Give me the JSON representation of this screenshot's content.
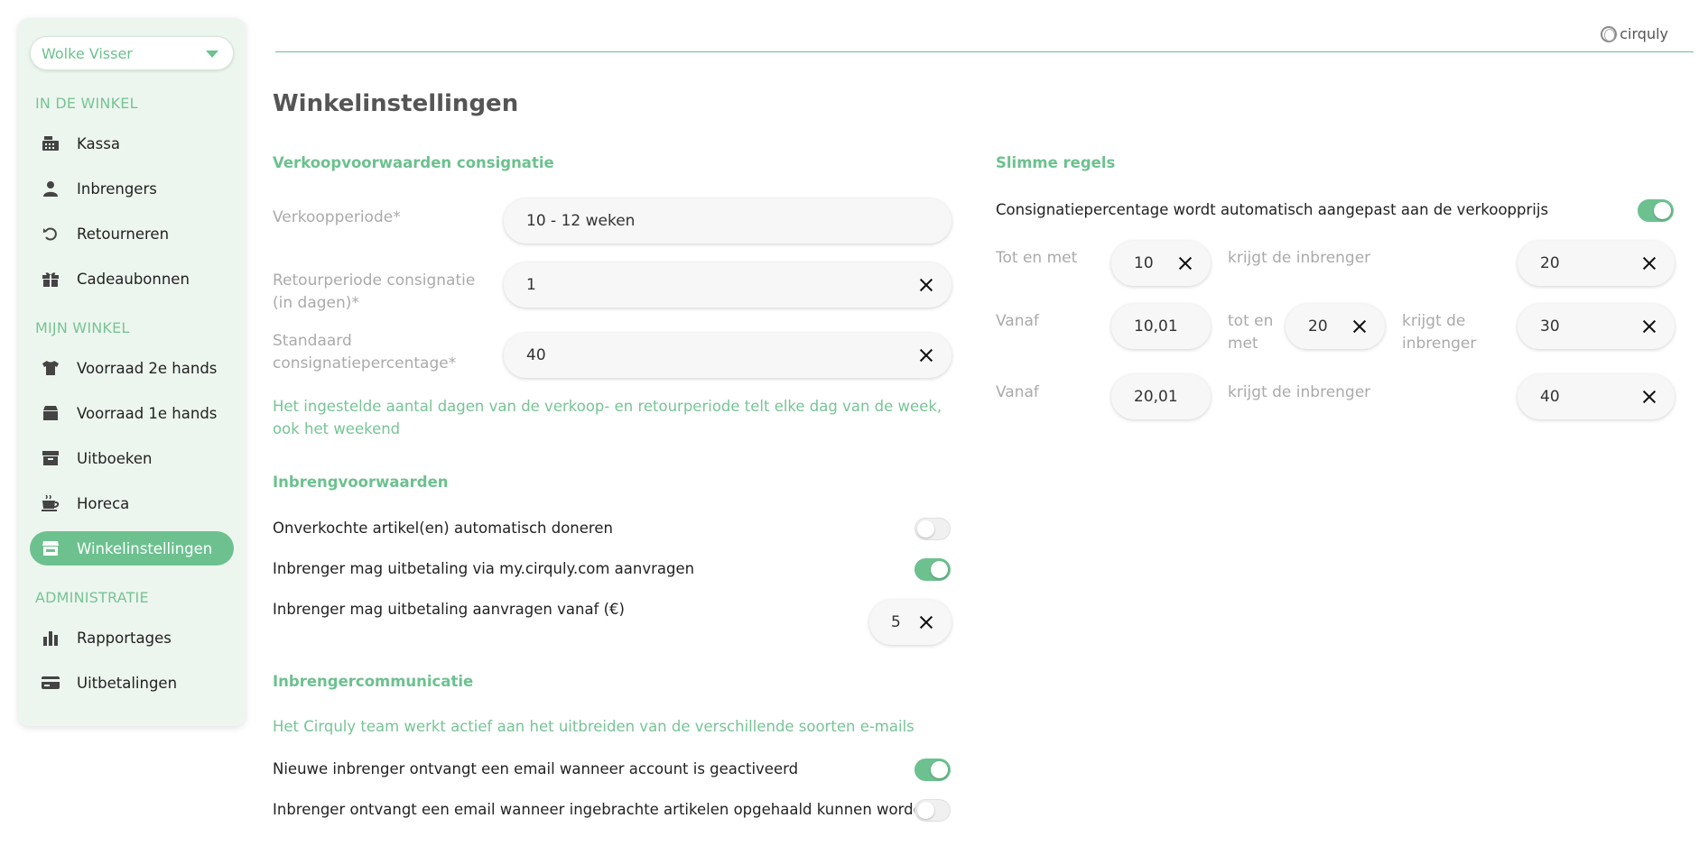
{
  "sidebar": {
    "user": "Wolke Visser",
    "sections": [
      {
        "label": "IN DE WINKEL"
      },
      {
        "label": "MIJN WINKEL"
      },
      {
        "label": "ADMINISTRATIE"
      }
    ],
    "items": [
      {
        "label": "Kassa",
        "icon": "cash-register-icon"
      },
      {
        "label": "Inbrengers",
        "icon": "person-icon"
      },
      {
        "label": "Retourneren",
        "icon": "undo-icon"
      },
      {
        "label": "Cadeaubonnen",
        "icon": "gift-icon"
      },
      {
        "label": "Voorraad 2e hands",
        "icon": "shirt-icon"
      },
      {
        "label": "Voorraad 1e hands",
        "icon": "box-icon"
      },
      {
        "label": "Uitboeken",
        "icon": "archive-icon"
      },
      {
        "label": "Horeca",
        "icon": "coffee-icon"
      },
      {
        "label": "Winkelinstellingen",
        "icon": "store-icon",
        "active": true
      },
      {
        "label": "Rapportages",
        "icon": "bar-chart-icon"
      },
      {
        "label": "Uitbetalingen",
        "icon": "credit-card-icon"
      }
    ]
  },
  "header": {
    "logo": "cirquly",
    "accent": "#6cc18f"
  },
  "page": {
    "title": "Winkelinstellingen"
  },
  "sales": {
    "heading": "Verkoopvoorwaarden consignatie",
    "period_label": "Verkoopperiode*",
    "period_value": "10 - 12 weken",
    "return_label": "Retourperiode consignatie (in dagen)*",
    "return_value": "1",
    "pct_label": "Standaard consignatiepercentage*",
    "pct_value": "40",
    "note": "Het ingestelde aantal dagen van de verkoop- en retourperiode telt elke dag van de week, ook het weekend"
  },
  "intake": {
    "heading": "Inbrengvoorwaarden",
    "donate_label": "Onverkochte artikel(en) automatisch doneren",
    "donate_on": false,
    "payout_label": "Inbrenger mag uitbetaling via my.cirquly.com aanvragen",
    "payout_on": true,
    "min_label": "Inbrenger mag uitbetaling aanvragen vanaf (€)",
    "min_value": "5"
  },
  "comms": {
    "heading": "Inbrengercommunicatie",
    "note": "Het Cirquly team werkt actief aan het uitbreiden van de verschillende soorten e-mails",
    "email1_label": "Nieuwe inbrenger ontvangt een email wanneer account is geactiveerd",
    "email1_on": true,
    "email2_label": "Inbrenger ontvangt een email wanneer ingebrachte artikelen opgehaald kunnen worden",
    "email2_on": false
  },
  "rules": {
    "heading": "Slimme regels",
    "auto_label": "Consignatiepercentage wordt automatisch aangepast aan de verkoopprijs",
    "auto_on": true,
    "row1": {
      "lead": "Tot en met",
      "a": "10",
      "gets": "krijgt de inbrenger",
      "pct": "20"
    },
    "row2": {
      "lead": "Vanaf",
      "a": "10,01",
      "mid": "tot en met",
      "b": "20",
      "gets": "krijgt de inbrenger",
      "pct": "30"
    },
    "row3": {
      "lead": "Vanaf",
      "a": "20,01",
      "gets": "krijgt de inbrenger",
      "pct": "40"
    }
  }
}
